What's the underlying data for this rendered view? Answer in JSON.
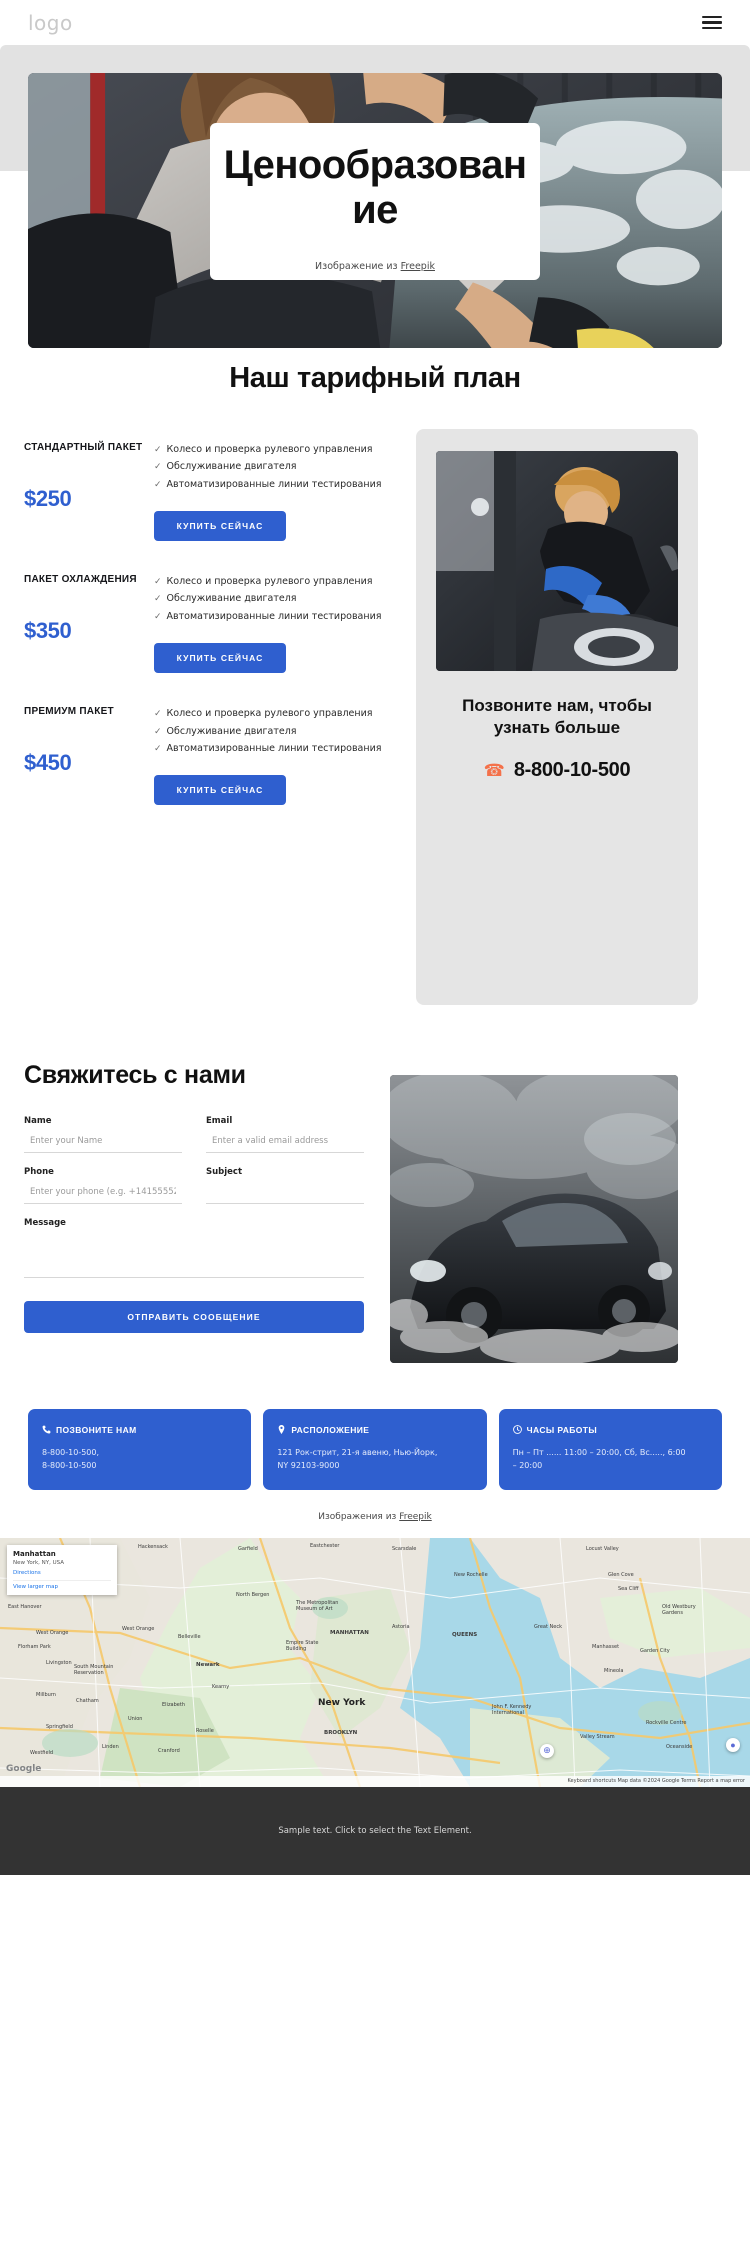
{
  "header": {
    "logo": "logo",
    "menu_icon": "hamburger-icon"
  },
  "hero": {
    "title": "Ценообразование",
    "caption_prefix": "Изображение из ",
    "caption_link": "Freepik"
  },
  "pricing": {
    "section_title": "Наш тарифный план",
    "plans": [
      {
        "name": "СТАНДАРТНЫЙ ПАКЕТ",
        "price": "$250",
        "features": [
          "Колесо и проверка рулевого управления",
          "Обслуживание двигателя",
          "Автоматизированные линии тестирования"
        ],
        "button": "КУПИТЬ СЕЙЧАС"
      },
      {
        "name": "ПАКЕТ ОХЛАЖДЕНИЯ",
        "price": "$350",
        "features": [
          "Колесо и проверка рулевого управления",
          "Обслуживание двигателя",
          "Автоматизированные линии тестирования"
        ],
        "button": "КУПИТЬ СЕЙЧАС"
      },
      {
        "name": "ПРЕМИУМ ПАКЕТ",
        "price": "$450",
        "features": [
          "Колесо и проверка рулевого управления",
          "Обслуживание двигателя",
          "Автоматизированные линии тестирования"
        ],
        "button": "КУПИТЬ СЕЙЧАС"
      }
    ],
    "call_panel": {
      "heading": "Позвоните нам, чтобы узнать больше",
      "phone": "8-800-10-500",
      "phone_icon": "phone-icon"
    }
  },
  "contact": {
    "title": "Свяжитесь с нами",
    "fields": {
      "name_label": "Name",
      "name_placeholder": "Enter your Name",
      "email_label": "Email",
      "email_placeholder": "Enter a valid email address",
      "phone_label": "Phone",
      "phone_placeholder": "Enter your phone (e.g. +14155552671)",
      "subject_label": "Subject",
      "subject_placeholder": "",
      "message_label": "Message",
      "message_value": ""
    },
    "submit": "ОТПРАВИТЬ СООБЩЕНИЕ"
  },
  "info_cards": [
    {
      "icon": "phone-icon",
      "title": "ПОЗВОНИТЕ НАМ",
      "body": "8-800-10-500,\n8-800-10-500"
    },
    {
      "icon": "map-pin-icon",
      "title": "РАСПОЛОЖЕНИЕ",
      "body": "121 Рок-стрит, 21-я авеню, Нью-Йорк,\nNY 92103-9000"
    },
    {
      "icon": "clock-icon",
      "title": "ЧАСЫ РАБОТЫ",
      "body": "Пн – Пт ...... 11:00 – 20:00, Сб, Вс....., 6:00\n– 20:00"
    }
  ],
  "images_credit": {
    "prefix": "Изображения из ",
    "link": "Freepik"
  },
  "map": {
    "info_title": "Manhattan",
    "info_sub": "New York, NY, USA",
    "directions": "Directions",
    "larger_map": "View larger map",
    "center_label": "New York",
    "labels": [
      "Garfield",
      "Hackensack",
      "Scarsdale",
      "Eastchester",
      "Locust Valley",
      "New Rochelle",
      "Glen Cove",
      "Sea Cliff",
      "Old Westbury Gardens",
      "North Bergen",
      "The Metropolitan Museum of Art",
      "MANHATTAN",
      "Empire State Building",
      "Astoria",
      "Great Neck",
      "Manhasset",
      "QUEENS",
      "Garden City",
      "Mineola",
      "West Orange",
      "Newark",
      "South Mountain Reservation",
      "Elizabeth",
      "BROOKLYN",
      "John F. Kennedy International",
      "Rockville Centre",
      "Valley Stream",
      "Oceanside",
      "Springfield",
      "Westfield",
      "Linden",
      "Cranford",
      "Millburn",
      "Livingston",
      "Belleville",
      "West Orange",
      "Kearny",
      "East Hanover",
      "Florham Park",
      "Chatham",
      "Union",
      "Roselle"
    ],
    "bottom_bar": "Keyboard shortcuts   Map data ©2024 Google   Terms   Report a map error",
    "brand": "Google"
  },
  "footer": {
    "text": "Sample text. Click to select the Text Element."
  },
  "colors": {
    "accent_blue": "#2f5fcf",
    "phone_orange": "#f4714a",
    "panel_grey": "#e5e5e5",
    "footer_dark": "#333333"
  }
}
